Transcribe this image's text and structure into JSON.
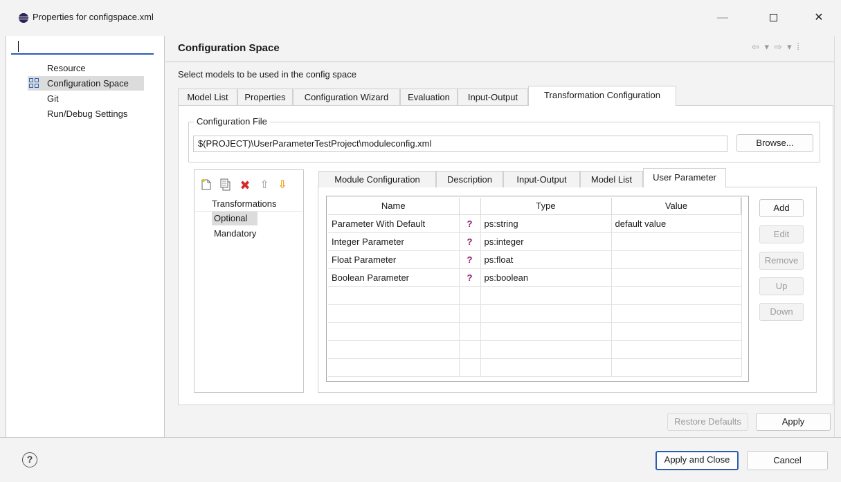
{
  "window": {
    "title": "Properties for configspace.xml",
    "minimize": "—",
    "close": "✕"
  },
  "sidebar": {
    "filter_value": "",
    "items": [
      {
        "label": "Resource"
      },
      {
        "label": "Configuration Space",
        "selected": true
      },
      {
        "label": "Git"
      },
      {
        "label": "Run/Debug Settings"
      }
    ]
  },
  "page": {
    "title": "Configuration Space",
    "nav_arrows": "⇦ ▾ ⇨ ▾ ⁞",
    "description": "Select models to be used in the config space",
    "tabs": [
      {
        "label": "Model List"
      },
      {
        "label": "Properties"
      },
      {
        "label": "Configuration Wizard"
      },
      {
        "label": "Evaluation"
      },
      {
        "label": "Input-Output"
      },
      {
        "label": "Transformation Configuration",
        "active": true
      }
    ]
  },
  "config_file": {
    "legend": "Configuration File",
    "path": "$(PROJECT)\\UserParameterTestProject\\moduleconfig.xml",
    "browse_label": "Browse..."
  },
  "tree": {
    "toolbar_icons": [
      "new-icon",
      "copy-icon",
      "delete-icon",
      "move-up-icon",
      "move-down-icon"
    ],
    "root": "Transformations",
    "children": [
      {
        "label": "Optional",
        "selected": true
      },
      {
        "label": "Mandatory"
      }
    ]
  },
  "inner_tabs": [
    {
      "label": "Module Configuration"
    },
    {
      "label": "Description"
    },
    {
      "label": "Input-Output"
    },
    {
      "label": "Model List"
    },
    {
      "label": "User Parameter",
      "active": true
    }
  ],
  "param_table": {
    "headers": [
      "Name",
      "",
      "Type",
      "Value"
    ],
    "rows": [
      {
        "name": "Parameter With Default",
        "icon": "?",
        "type": "ps:string",
        "value": "default value"
      },
      {
        "name": "Integer Parameter",
        "icon": "?",
        "type": "ps:integer",
        "value": ""
      },
      {
        "name": "Float Parameter",
        "icon": "?",
        "type": "ps:float",
        "value": ""
      },
      {
        "name": "Boolean Parameter",
        "icon": "?",
        "type": "ps:boolean",
        "value": ""
      }
    ]
  },
  "side_buttons": {
    "add": "Add",
    "edit": "Edit",
    "remove": "Remove",
    "up": "Up",
    "down": "Down"
  },
  "page_buttons": {
    "restore": "Restore Defaults",
    "apply": "Apply"
  },
  "footer": {
    "help": "?",
    "apply_close": "Apply and Close",
    "cancel": "Cancel"
  },
  "colors": {
    "accent": "#2a5db0",
    "delete_red": "#d42a2a",
    "arrow_orange": "#e8a317",
    "help_purple": "#8a1a6e"
  }
}
